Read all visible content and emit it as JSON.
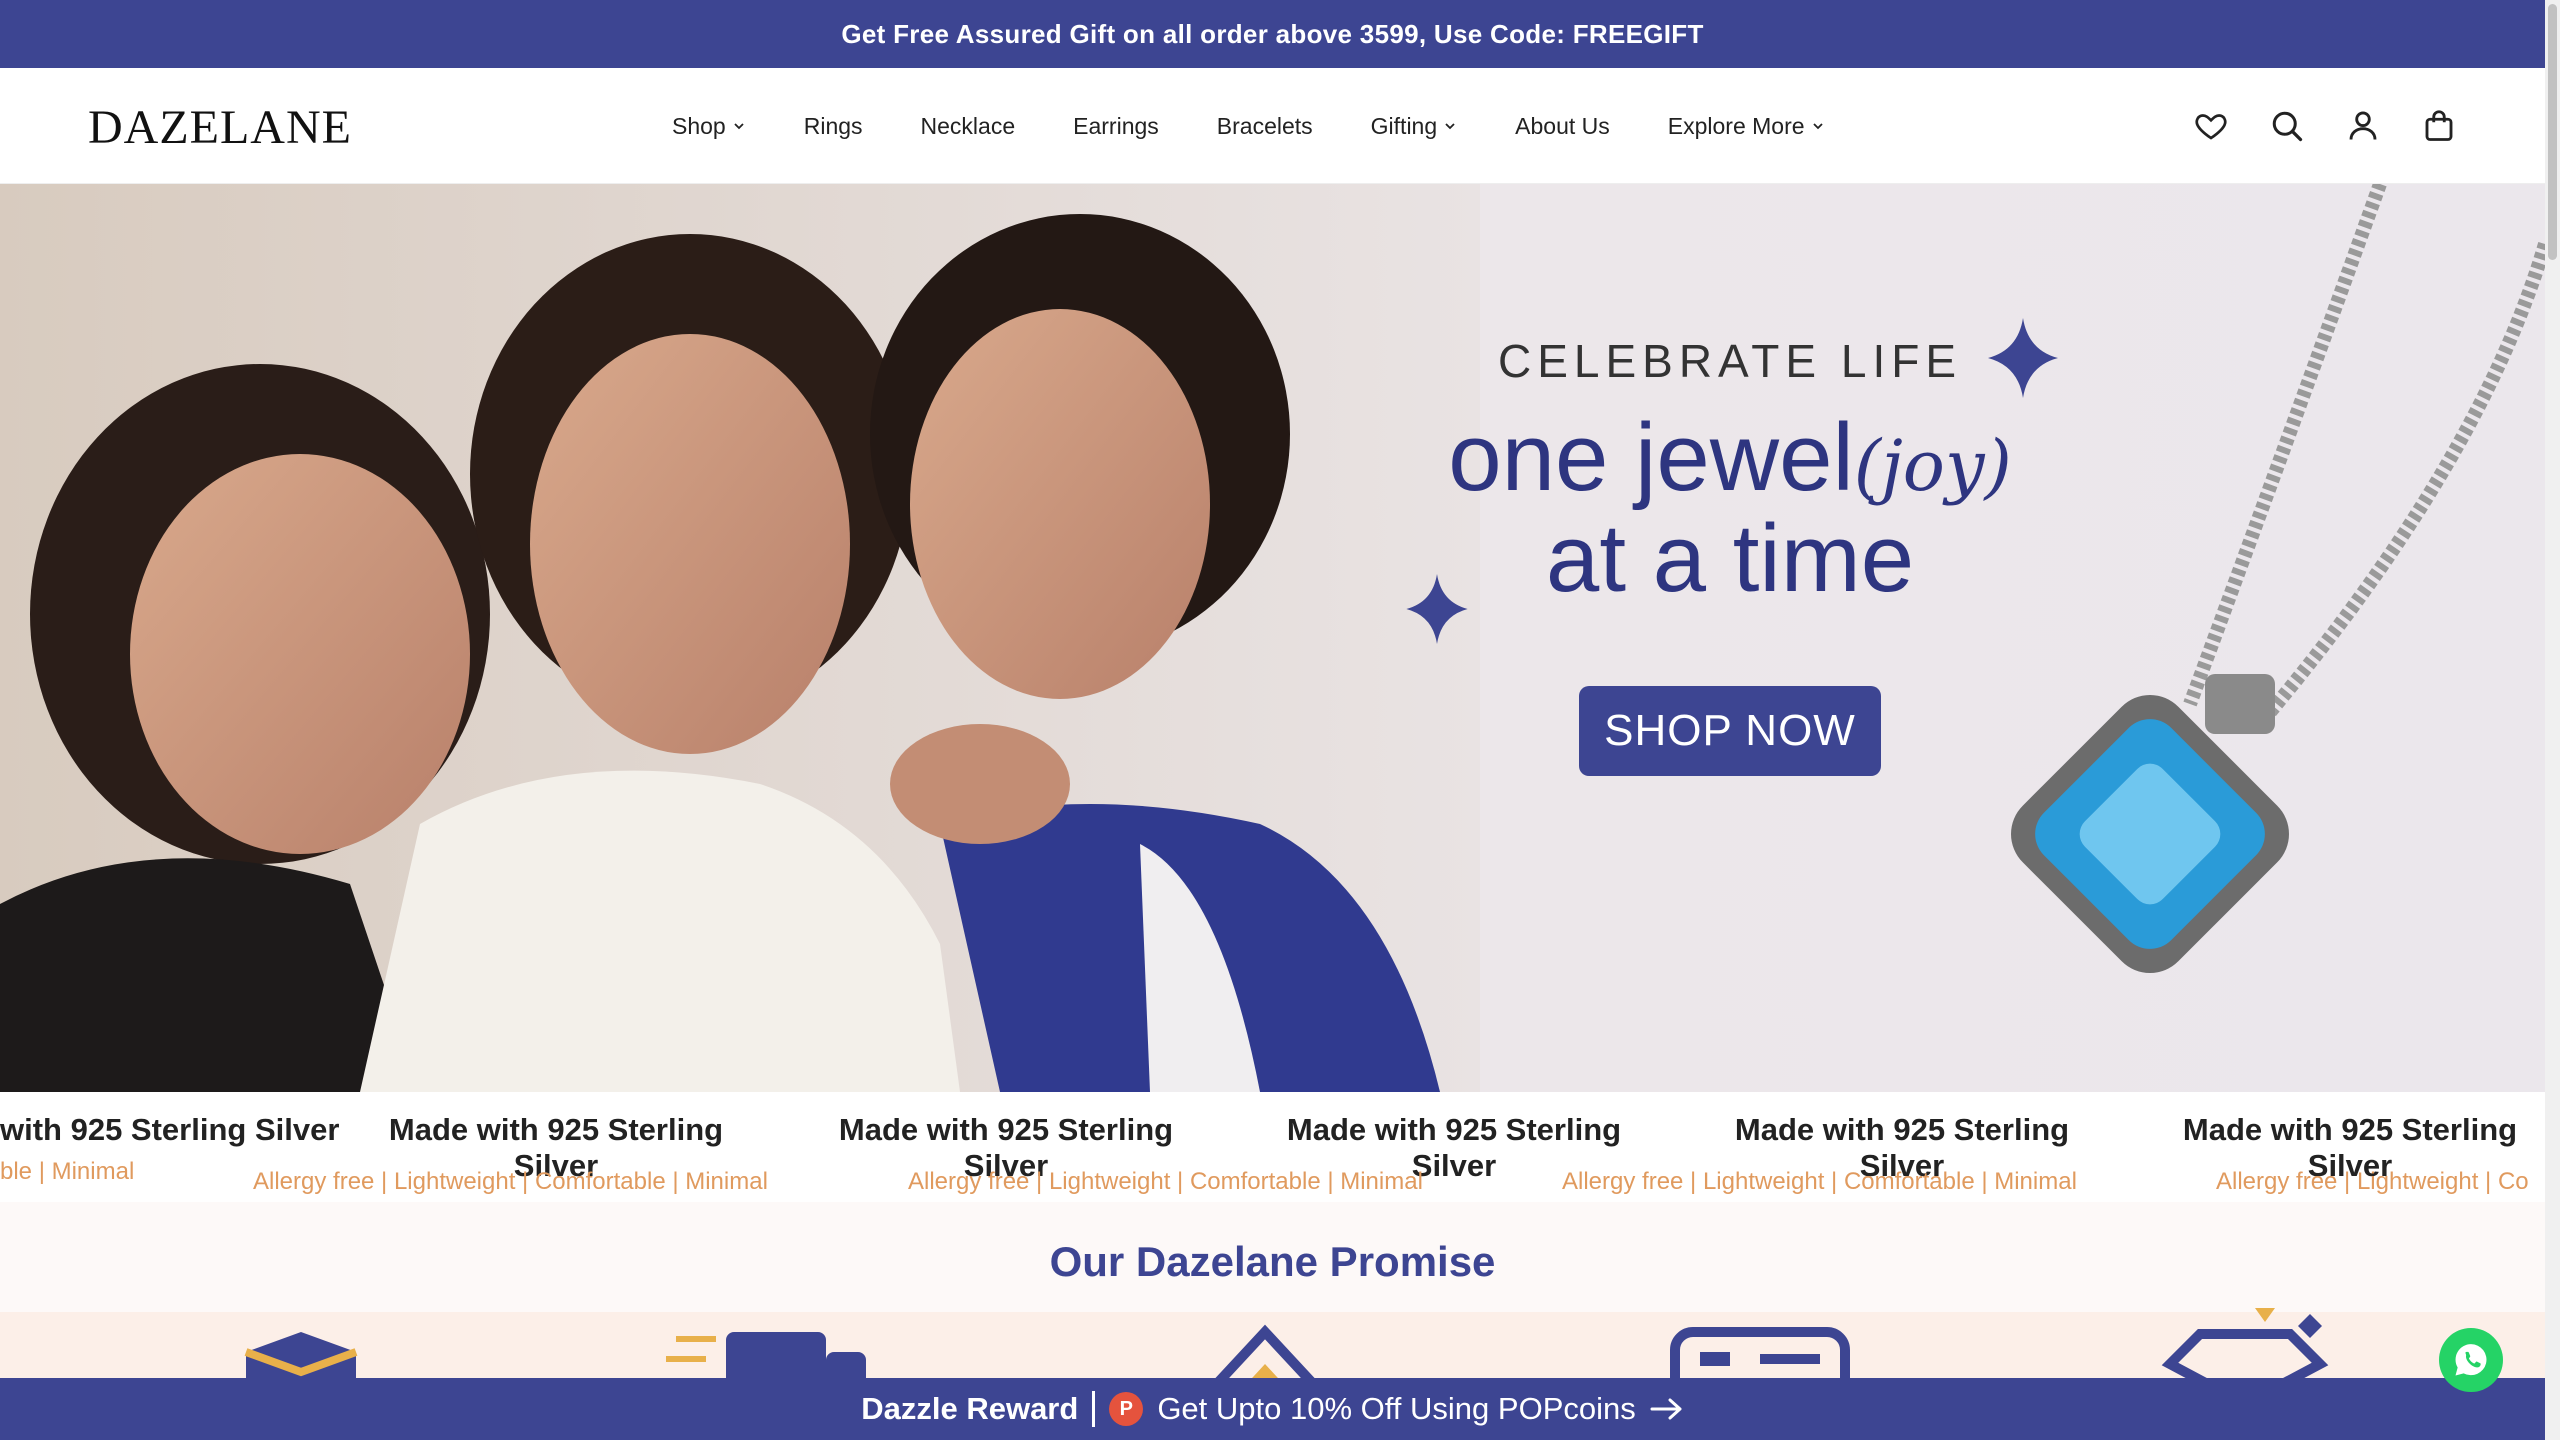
{
  "announcement": "Get Free Assured Gift on all order above 3599, Use Code: FREEGIFT",
  "brand": "DAZELANE",
  "nav": [
    {
      "label": "Shop",
      "dropdown": true
    },
    {
      "label": "Rings",
      "dropdown": false
    },
    {
      "label": "Necklace",
      "dropdown": false
    },
    {
      "label": "Earrings",
      "dropdown": false
    },
    {
      "label": "Bracelets",
      "dropdown": false
    },
    {
      "label": "Gifting",
      "dropdown": true
    },
    {
      "label": "About Us",
      "dropdown": false
    },
    {
      "label": "Explore More",
      "dropdown": true
    }
  ],
  "header_icons": [
    "heart-icon",
    "search-icon",
    "user-icon",
    "bag-icon"
  ],
  "hero": {
    "eyebrow": "CELEBRATE LIFE",
    "line1": "one jewel",
    "line1_script": "(joy)",
    "line2": "at a time",
    "cta": "SHOP NOW"
  },
  "marquee": {
    "title": "Made with 925 Sterling Silver",
    "subtitle": "Allergy free | Lightweight | Comfortable | Minimal",
    "partial_title_left": "with 925 Sterling Silver",
    "partial_sub_left": "ble | Minimal",
    "partial_sub_right": "Allergy free | Lightweight | Co"
  },
  "promise": {
    "title": "Our Dazelane Promise"
  },
  "reward": {
    "label": "Dazzle Reward",
    "coin": "P",
    "text": "Get Upto 10% Off Using POPcoins"
  },
  "colors": {
    "brand_navy": "#3d4592",
    "accent_peach": "#e09a5e",
    "whatsapp": "#25d366"
  }
}
